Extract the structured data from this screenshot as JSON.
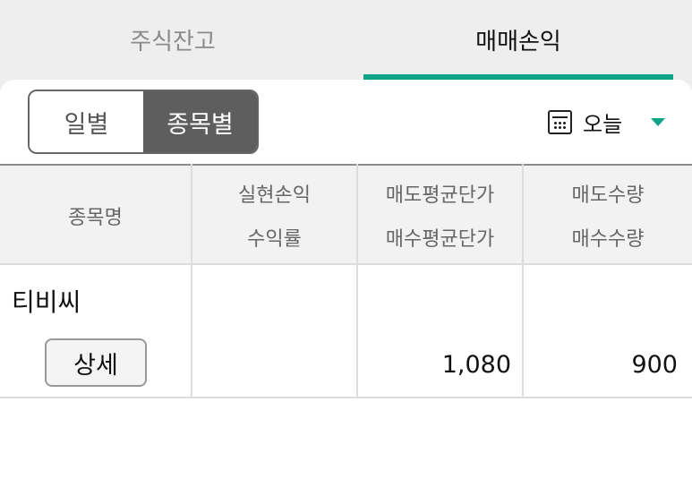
{
  "tabs": [
    {
      "label": "주식잔고",
      "active": false
    },
    {
      "label": "매매손익",
      "active": true
    }
  ],
  "colors": {
    "accent": "#0fa487",
    "segment_active": "#5e5e5e"
  },
  "segment": {
    "options": [
      "일별",
      "종목별"
    ],
    "selected": "종목별"
  },
  "date_filter": {
    "icon": "calendar-icon",
    "value": "오늘"
  },
  "table": {
    "headers": {
      "name": "종목명",
      "col1": [
        "실현손익",
        "수익률"
      ],
      "col2": [
        "매도평균단가",
        "매수평균단가"
      ],
      "col3": [
        "매도수량",
        "매수수량"
      ]
    },
    "rows": [
      {
        "name": "티비씨",
        "detail_label": "상세",
        "realized_pl": "",
        "return_rate": "",
        "sell_avg_price": "1,080",
        "sell_qty": "900"
      }
    ]
  }
}
